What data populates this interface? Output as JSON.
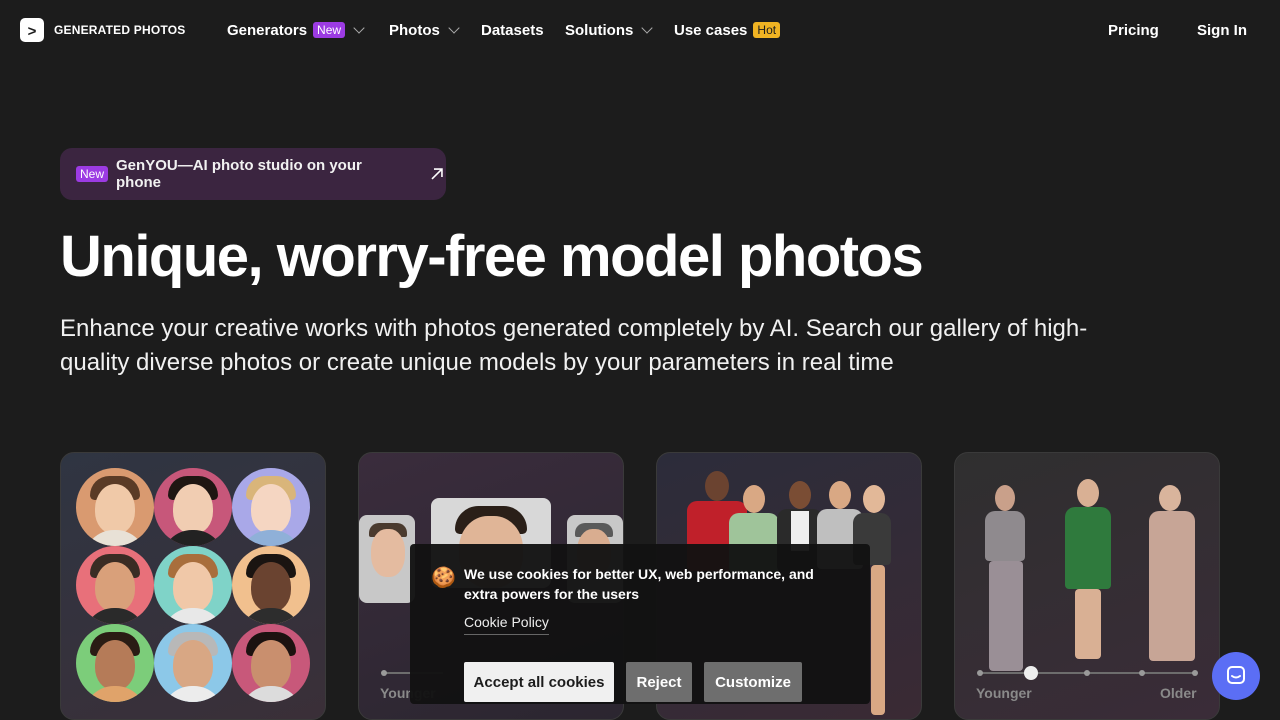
{
  "brand": {
    "name": "GENERATED PHOTOS",
    "mark": ">"
  },
  "nav": {
    "generators": "Generators",
    "generators_badge": "New",
    "photos": "Photos",
    "datasets": "Datasets",
    "solutions": "Solutions",
    "use_cases": "Use cases",
    "use_cases_badge": "Hot",
    "pricing": "Pricing",
    "sign_in": "Sign In"
  },
  "promo": {
    "badge": "New",
    "text": "GenYOU—AI photo studio on your phone"
  },
  "hero": {
    "title": "Unique, worry-free model photos",
    "subtitle": "Enhance your creative works with photos generated completely by AI. Search our gallery of high-quality diverse photos or create unique models by your parameters in real time"
  },
  "cards": {
    "card2_label_left": "Younger",
    "card4_label_left": "Younger",
    "card4_label_right": "Older"
  },
  "cookie": {
    "icon": "🍪",
    "text": "We use cookies for better UX, web performance, and extra powers for the users",
    "policy_link": "Cookie Policy",
    "accept": "Accept all cookies",
    "reject": "Reject",
    "customize": "Customize"
  },
  "colors": {
    "background": "#1c1c1c",
    "badge_new": "#9c3be3",
    "badge_hot": "#f0b323",
    "chat": "#5b6ef5"
  }
}
